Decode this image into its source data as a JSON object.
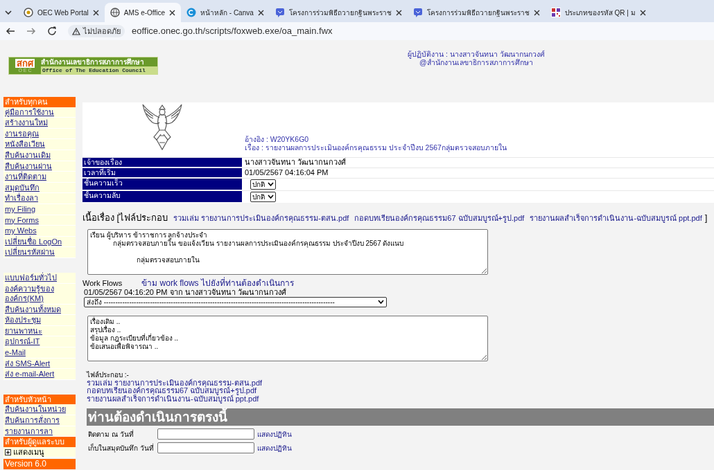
{
  "browser": {
    "tabs": [
      {
        "title": "OEC Web Portal",
        "kind": "portal",
        "selected": false
      },
      {
        "title": "AMS e-Office",
        "kind": "globe",
        "selected": true
      },
      {
        "title": "หน้าหลัก - Canva",
        "kind": "canva",
        "selected": false
      },
      {
        "title": "โครงการร่วมพิธีถวายกฐินพระราช",
        "kind": "chat",
        "selected": false
      },
      {
        "title": "โครงการร่วมพิธีถวายกฐินพระราช",
        "kind": "chat",
        "selected": false
      },
      {
        "title": "ประเภทของรหัส QR | ม",
        "kind": "qr",
        "selected": false
      }
    ],
    "security": "ไม่ปลอดภัย",
    "url": "eoffice.onec.go.th/scripts/foxweb.exe/oa_main.fwx"
  },
  "header": {
    "logo": {
      "mark": "สกศ",
      "mark_sub": "O E C",
      "name_th": "สำนักงานเลขาธิการสภาการศึกษา",
      "name_en": "Office of The Education Council"
    },
    "user": "ผู้ปฏิบัติงาน : นางสาวจันทนา วัฒนากนกวงศ์",
    "org": "@สำนักงานเลขาธิการสภาการศึกษา"
  },
  "sidebar": {
    "groups": [
      {
        "header": "สำหรับทุกคน",
        "items": [
          {
            "label": "คู่มือการใช้งาน",
            "kind": "link"
          },
          {
            "label": "สร้างงานใหม่",
            "kind": "link"
          },
          {
            "label": "งานรอคุณ",
            "kind": "link"
          },
          {
            "label": "หนังสือเวียน",
            "kind": "link"
          },
          {
            "label": "สืบค้นงานเดิม",
            "kind": "link"
          },
          {
            "label": "สืบค้นงานผ่าน",
            "kind": "link"
          },
          {
            "label": "งานที่ติดตาม",
            "kind": "link"
          },
          {
            "label": "สมุดบันทึก",
            "kind": "link"
          },
          {
            "label": "ทำเรื่องลา",
            "kind": "link"
          },
          {
            "label": "my Filing",
            "kind": "link"
          },
          {
            "label": "my Forms",
            "kind": "link"
          },
          {
            "label": "my Webs",
            "kind": "link"
          },
          {
            "label": "เปลี่ยนชื่อ LogOn",
            "kind": "link"
          },
          {
            "label": "เปลี่ยนรหัสผ่าน",
            "kind": "link"
          }
        ]
      },
      {
        "items": [
          {
            "label": "แบบฟอร์มทั่วไป",
            "kind": "link"
          },
          {
            "label": "องค์ความรู้ขององค์กร(KM)",
            "kind": "link"
          },
          {
            "label": "สืบค้นงานทั้งหมด",
            "kind": "link"
          },
          {
            "label": "ห้องประชุม",
            "kind": "link"
          },
          {
            "label": "ยานพาหนะ",
            "kind": "link"
          },
          {
            "label": "อุปกรณ์-IT",
            "kind": "link"
          },
          {
            "label": "e-Mail",
            "kind": "link"
          },
          {
            "label": "ส่ง SMS-Alert",
            "kind": "link"
          },
          {
            "label": "ส่ง e-mail-Alert",
            "kind": "link"
          }
        ]
      },
      {
        "header": "สำหรับหัวหน้า",
        "items": [
          {
            "label": "สืบค้นงานในหน่วย",
            "kind": "link"
          },
          {
            "label": "สืบค้นการสั่งการ",
            "kind": "link"
          },
          {
            "label": "รายงานการลา",
            "kind": "link"
          }
        ]
      },
      {
        "header": "สำหรับผู้ดูแลระบบ",
        "items": [
          {
            "label": "แสดงเมนู",
            "kind": "expander",
            "expanded": false
          }
        ]
      }
    ],
    "version": "Version 6.0"
  },
  "document": {
    "reference": "อ้างอิง : W20YK6G0",
    "subject": "เรื่อง : รายงานผลการประเมินองค์กรคุณธรรม ประจำปีงบ 2567กลุ่มตรวจสอบภายใน",
    "fields": [
      {
        "label": "เจ้าของเรื่อง",
        "kind": "text",
        "value": "นางสาวจันทนา วัฒนากนกวงศ์"
      },
      {
        "label": "เวลาที่เริ่ม",
        "kind": "text",
        "value": "01/05/2567 04:16:04 PM"
      },
      {
        "label": "ชั้นความเร็ว",
        "kind": "select",
        "value": "ปกติ"
      },
      {
        "label": "ชั้นความลับ",
        "kind": "select",
        "value": "ปกติ"
      }
    ],
    "body_label": "เนื้อเรื่อง",
    "attach_open": "[ไฟล์ประกอบ",
    "attach_close": "]",
    "attachments": [
      "รวมเล่ม รายงานการประเมินองค์กรคุณธรรม-ตสน.pdf",
      "กอดบทเรียนองค์กรคุณธรรม67 ฉบับสมบูรณ์+รูป.pdf",
      "รายงานผลสำเร็จการดำเนินงาน-ฉบับสมบูรณ์ ppt.pdf"
    ],
    "body_text": "เรียน ผู้บริหาร ข้าราชการ ลูกจ้างประจำ\n            กลุ่มตรวจสอบภายใน ขอแจ้งเวียน รายงานผลการประเมินองค์กรคุณธรรม ประจำปีงบ 2567 ดังแนบ\n\n                        กลุ่มตรวจสอบภายใน"
  },
  "workflow": {
    "label": "Work Flows",
    "skip_link": "ข้าม work flows ไปยังที่ท่านต้องดำเนินการ",
    "entry": "01/05/2567 04:16:20 PM จาก นางสาวจันทนา วัฒนากนกวงศ์",
    "send_to": "ส่งถึง ----------------------------------------------------------------------------------------------------",
    "note_text": "เรื่องเดิม ..\nสรุปเรื่อง ..\nข้อมูล กฎระเบียบที่เกี่ยวข้อง ..\nข้อเสนอเพื่อพิจารณา .."
  },
  "files": {
    "label": "ไฟล์ประกอบ :-",
    "items": [
      "รวมเล่ม รายงานการประเมินองค์กรคุณธรรม-ตสน.pdf",
      "กอดบทเรียนองค์กรคุณธรรม67 ฉบับสมบูรณ์+รูป.pdf",
      "รายงานผลสำเร็จการดำเนินงาน-ฉบับสมบูรณ์ ppt.pdf"
    ]
  },
  "action": {
    "title": "ท่านต้องดำเนินการตรงนี้",
    "rows": [
      {
        "label": "ติดตาม ณ วันที่",
        "link": "แสดงปฏิทิน"
      },
      {
        "label": "เก็บในสมุดบันทึก วันที่",
        "link": "แสดงปฏิทิน"
      }
    ]
  }
}
